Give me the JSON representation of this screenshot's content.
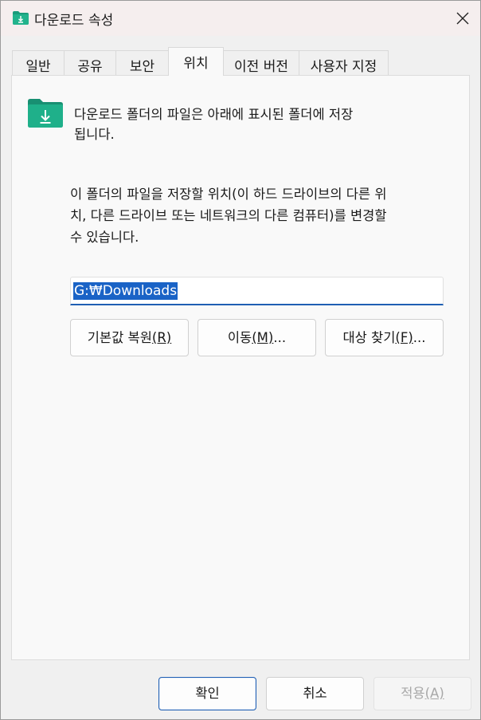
{
  "window": {
    "title": "다운로드 속성",
    "close_icon": "close-icon"
  },
  "tabs": [
    {
      "label": "일반"
    },
    {
      "label": "공유"
    },
    {
      "label": "보안"
    },
    {
      "label": "위치",
      "active": true
    },
    {
      "label": "이전 버전"
    },
    {
      "label": "사용자 지정"
    }
  ],
  "location": {
    "folder_icon": "download-folder-icon",
    "description_line1": "다운로드 폴더의 파일은 아래에 표시된 폴더에 저장",
    "description_line2": "됩니다.",
    "info_line1": "이 폴더의 파일을 저장할 위치(이 하드 드라이브의 다른 위",
    "info_line2": "치, 다른 드라이브 또는 네트워크의 다른 컴퓨터)를 변경할",
    "info_line3": "수 있습니다.",
    "path_value": "G:₩Downloads",
    "restore_label": "기본값 복원",
    "restore_key": "(R)",
    "move_label": "이동",
    "move_key": "(M)",
    "move_suffix": "...",
    "find_label": "대상 찾기",
    "find_key": "(F)",
    "find_suffix": "..."
  },
  "footer": {
    "ok_label": "확인",
    "cancel_label": "취소",
    "apply_label": "적용",
    "apply_key": "(A)"
  },
  "colors": {
    "accent": "#1a63c6",
    "folder_green": "#1a9c7b"
  }
}
